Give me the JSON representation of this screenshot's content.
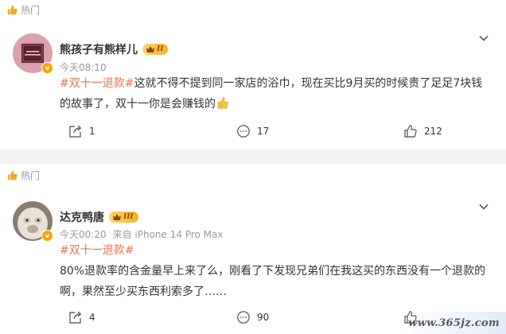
{
  "posts": [
    {
      "hot_label": "热门",
      "user": {
        "name": "熊孩子有熊样儿",
        "level": "II",
        "verified_badge": "v",
        "avatar_text": "Hello FRIENDS"
      },
      "meta": {
        "time": "今天08:10",
        "source": ""
      },
      "content": {
        "topic": "#双十一退款#",
        "text": "这就不得不提到同一家店的浴巾，现在买比9月买的时候贵了足足7块钱的故事了，双十一你是会赚钱的"
      },
      "actions": {
        "share": "1",
        "comment": "17",
        "like": "212"
      }
    },
    {
      "hot_label": "热门",
      "user": {
        "name": "达克鸭唐",
        "level": "III",
        "verified_badge": "v"
      },
      "meta": {
        "time": "今天00:20",
        "source": "来自 iPhone 14 Pro Max"
      },
      "content": {
        "topic": "#双十一退款#",
        "text": "80%退款率的含金量早上来了么，刚看了下发现兄弟们在我这买的东西没有一个退款的啊，果然至少买东西利索多了……"
      },
      "actions": {
        "share": "4",
        "comment": "90",
        "like": ""
      }
    }
  ],
  "watermark": "www.365jz.com",
  "colors": {
    "topic": "#eb7350",
    "hot_icon": "#f5a623",
    "badge": "#f7a500"
  }
}
